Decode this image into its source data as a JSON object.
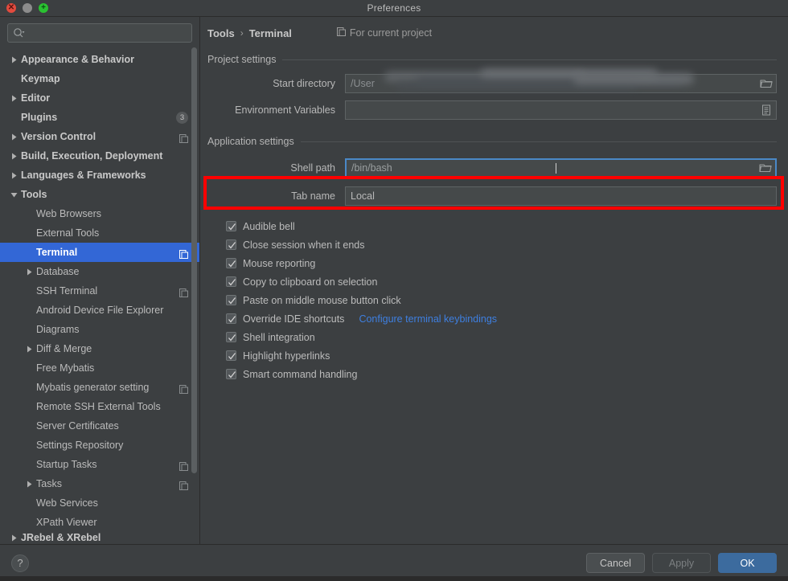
{
  "window": {
    "title": "Preferences",
    "controls": {
      "close": "close-window",
      "minimize": "minimize-window",
      "maximize": "maximize-window"
    }
  },
  "sidebar": {
    "search": {
      "placeholder": "",
      "value": "",
      "icon": "search-icon"
    },
    "items": [
      {
        "label": "Appearance & Behavior",
        "level": 0,
        "arrow": "right",
        "bold": true
      },
      {
        "label": "Keymap",
        "level": 0,
        "arrow": "none",
        "bold": true
      },
      {
        "label": "Editor",
        "level": 0,
        "arrow": "right",
        "bold": true
      },
      {
        "label": "Plugins",
        "level": 0,
        "arrow": "none",
        "bold": true,
        "badge": "3"
      },
      {
        "label": "Version Control",
        "level": 0,
        "arrow": "right",
        "bold": true,
        "copy": true
      },
      {
        "label": "Build, Execution, Deployment",
        "level": 0,
        "arrow": "right",
        "bold": true
      },
      {
        "label": "Languages & Frameworks",
        "level": 0,
        "arrow": "right",
        "bold": true
      },
      {
        "label": "Tools",
        "level": 0,
        "arrow": "down",
        "bold": true
      },
      {
        "label": "Web Browsers",
        "level": 1,
        "arrow": "none"
      },
      {
        "label": "External Tools",
        "level": 1,
        "arrow": "none"
      },
      {
        "label": "Terminal",
        "level": 1,
        "arrow": "none",
        "selected": true,
        "copy": true
      },
      {
        "label": "Database",
        "level": 1,
        "arrow": "right"
      },
      {
        "label": "SSH Terminal",
        "level": 1,
        "arrow": "none",
        "copy": true
      },
      {
        "label": "Android Device File Explorer",
        "level": 1,
        "arrow": "none"
      },
      {
        "label": "Diagrams",
        "level": 1,
        "arrow": "none"
      },
      {
        "label": "Diff & Merge",
        "level": 1,
        "arrow": "right"
      },
      {
        "label": "Free Mybatis",
        "level": 1,
        "arrow": "none"
      },
      {
        "label": "Mybatis generator setting",
        "level": 1,
        "arrow": "none",
        "copy": true
      },
      {
        "label": "Remote SSH External Tools",
        "level": 1,
        "arrow": "none"
      },
      {
        "label": "Server Certificates",
        "level": 1,
        "arrow": "none"
      },
      {
        "label": "Settings Repository",
        "level": 1,
        "arrow": "none"
      },
      {
        "label": "Startup Tasks",
        "level": 1,
        "arrow": "none",
        "copy": true
      },
      {
        "label": "Tasks",
        "level": 1,
        "arrow": "right",
        "copy": true
      },
      {
        "label": "Web Services",
        "level": 1,
        "arrow": "none"
      },
      {
        "label": "XPath Viewer",
        "level": 1,
        "arrow": "none"
      },
      {
        "label": "JRebel & XRebel",
        "level": 0,
        "arrow": "right",
        "bold": true,
        "clipped": true
      }
    ]
  },
  "main": {
    "breadcrumb": {
      "parent": "Tools",
      "separator": "›",
      "current": "Terminal"
    },
    "scope_note": {
      "icon": "copy-icon",
      "label": "For current project"
    },
    "project_settings": {
      "heading": "Project settings",
      "fields": [
        {
          "label": "Start directory",
          "value": "/User",
          "redacted": true,
          "icon": "folder-icon"
        },
        {
          "label": "Environment Variables",
          "value": "",
          "icon": "list-icon"
        }
      ]
    },
    "application_settings": {
      "heading": "Application settings",
      "shell_path": {
        "label": "Shell path",
        "value": "/bin/bash",
        "icon": "folder-icon",
        "focused": true
      },
      "tab_name": {
        "label": "Tab name",
        "value": "Local"
      },
      "checkboxes": [
        {
          "label": "Audible bell",
          "checked": true
        },
        {
          "label": "Close session when it ends",
          "checked": true
        },
        {
          "label": "Mouse reporting",
          "checked": true
        },
        {
          "label": "Copy to clipboard on selection",
          "checked": true
        },
        {
          "label": "Paste on middle mouse button click",
          "checked": true
        },
        {
          "label": "Override IDE shortcuts",
          "checked": true,
          "link": "Configure terminal keybindings"
        },
        {
          "label": "Shell integration",
          "checked": true
        },
        {
          "label": "Highlight hyperlinks",
          "checked": true
        },
        {
          "label": "Smart command handling",
          "checked": true
        }
      ]
    }
  },
  "footer": {
    "help": "?",
    "cancel": "Cancel",
    "apply": "Apply",
    "apply_disabled": true,
    "ok": "OK"
  },
  "annotation": {
    "type": "red-rectangle",
    "color": "#ff0000",
    "targets": "shell-path-row"
  },
  "colors": {
    "window_bg": "#3c3f41",
    "selection_blue": "#3367d6",
    "focus_border": "#4a88c7",
    "link_blue": "#3e7fe0",
    "ok_button": "#3c6b9e",
    "annotation_red": "#ff0000"
  }
}
